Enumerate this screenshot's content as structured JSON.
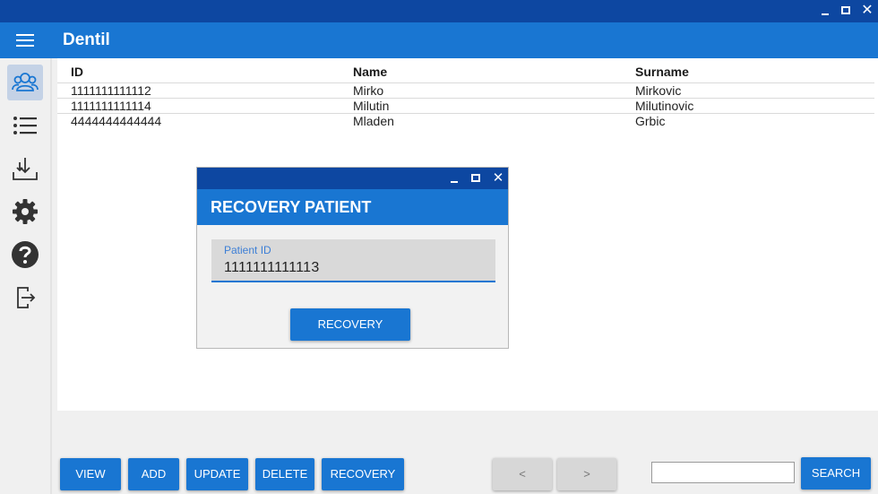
{
  "window": {
    "app_title": "Dentil",
    "controls": {
      "minimize_icon": "minimize-icon",
      "maximize_icon": "maximize-icon",
      "close": "✕"
    }
  },
  "sidebar": {
    "items": [
      {
        "name": "patients",
        "icon": "users-icon",
        "active": true
      },
      {
        "name": "list",
        "icon": "list-icon",
        "active": false
      },
      {
        "name": "download",
        "icon": "download-icon",
        "active": false
      },
      {
        "name": "settings",
        "icon": "gear-icon",
        "active": false
      },
      {
        "name": "help",
        "icon": "help-icon",
        "active": false
      },
      {
        "name": "logout",
        "icon": "logout-icon",
        "active": false
      }
    ]
  },
  "table": {
    "headers": [
      "ID",
      "Name",
      "Surname"
    ],
    "rows": [
      [
        "1111111111112",
        "Mirko",
        "Mirkovic"
      ],
      [
        "1111111111114",
        "Milutin",
        "Milutinovic"
      ],
      [
        "4444444444444",
        "Mladen",
        "Grbic"
      ]
    ]
  },
  "dialog": {
    "title": "RECOVERY PATIENT",
    "field_label": "Patient ID",
    "field_value": "1111111111113",
    "button": "RECOVERY",
    "close": "✕"
  },
  "toolbar": {
    "view": "VIEW",
    "add": "ADD",
    "update": "UPDATE",
    "delete": "DELETE",
    "recovery": "RECOVERY",
    "prev": "<",
    "next": ">",
    "search_value": "",
    "search": "SEARCH"
  },
  "colors": {
    "titlebar": "#0d47a1",
    "primary": "#1976d2",
    "sidebar_active": "#c4d2e6",
    "disabled_button": "#d7d7d7"
  }
}
